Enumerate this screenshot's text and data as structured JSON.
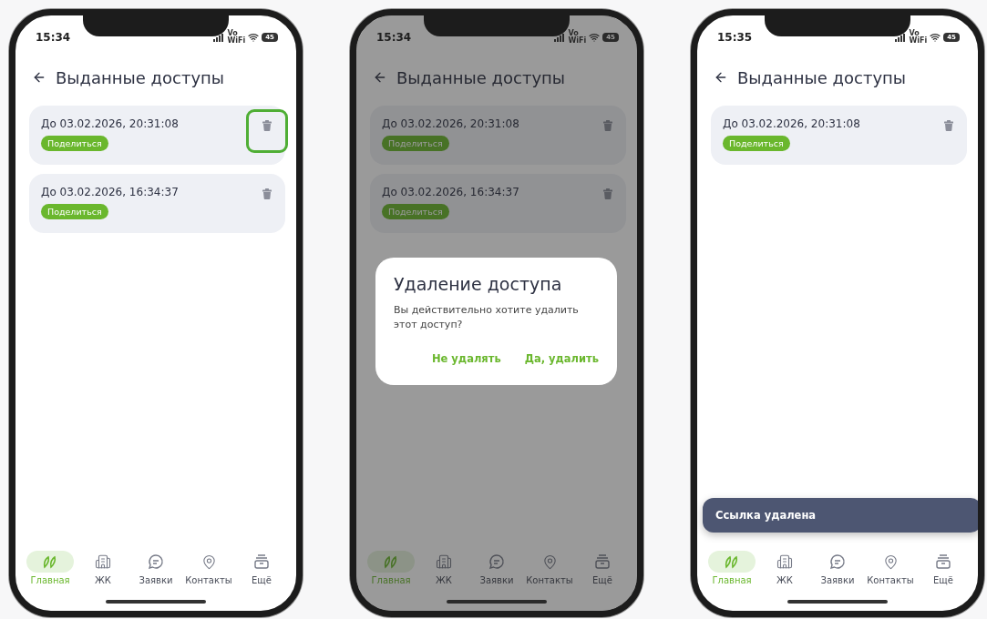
{
  "phones": [
    {
      "time": "15:34",
      "vowifi": [
        "Vo",
        "WiFi"
      ],
      "battery": "45",
      "title": "Выданные доступы",
      "dimmed": false,
      "accesses": [
        {
          "expires": "До 03.02.2026, 20:31:08",
          "share": "Поделиться",
          "highlighted": true
        },
        {
          "expires": "До 03.02.2026, 16:34:37",
          "share": "Поделиться",
          "highlighted": false
        }
      ],
      "nav": [
        {
          "label": "Главная",
          "kind": "home",
          "selected": true
        },
        {
          "label": "ЖК",
          "kind": "buildings",
          "selected": false
        },
        {
          "label": "Заявки",
          "kind": "requests",
          "selected": false
        },
        {
          "label": "Контакты",
          "kind": "contacts",
          "selected": false
        },
        {
          "label": "Ещё",
          "kind": "more",
          "selected": false
        }
      ]
    },
    {
      "time": "15:34",
      "vowifi": [
        "Vo",
        "WiFi"
      ],
      "battery": "45",
      "title": "Выданные доступы",
      "dimmed": true,
      "accesses": [
        {
          "expires": "До 03.02.2026, 20:31:08",
          "share": "Поделиться",
          "highlighted": false
        },
        {
          "expires": "До 03.02.2026, 16:34:37",
          "share": "Поделиться",
          "highlighted": false
        }
      ],
      "dialog": {
        "title": "Удаление доступа",
        "message": "Вы действительно хотите удалить этот доступ?",
        "buttons": [
          "Не удалять",
          "Да, удалить"
        ]
      },
      "nav": [
        {
          "label": "Главная",
          "kind": "home",
          "selected": true
        },
        {
          "label": "ЖК",
          "kind": "buildings",
          "selected": false
        },
        {
          "label": "Заявки",
          "kind": "requests",
          "selected": false
        },
        {
          "label": "Контакты",
          "kind": "contacts",
          "selected": false
        },
        {
          "label": "Ещё",
          "kind": "more",
          "selected": false
        }
      ]
    },
    {
      "time": "15:35",
      "vowifi": [
        "Vo",
        "WiFi"
      ],
      "battery": "45",
      "title": "Выданные доступы",
      "dimmed": false,
      "accesses": [
        {
          "expires": "До 03.02.2026, 20:31:08",
          "share": "Поделиться",
          "highlighted": false
        }
      ],
      "toast": "Ссылка удалена",
      "nav": [
        {
          "label": "Главная",
          "kind": "home",
          "selected": true
        },
        {
          "label": "ЖК",
          "kind": "buildings",
          "selected": false
        },
        {
          "label": "Заявки",
          "kind": "requests",
          "selected": false
        },
        {
          "label": "Контакты",
          "kind": "contacts",
          "selected": false
        },
        {
          "label": "Ещё",
          "kind": "more",
          "selected": false
        }
      ]
    }
  ]
}
